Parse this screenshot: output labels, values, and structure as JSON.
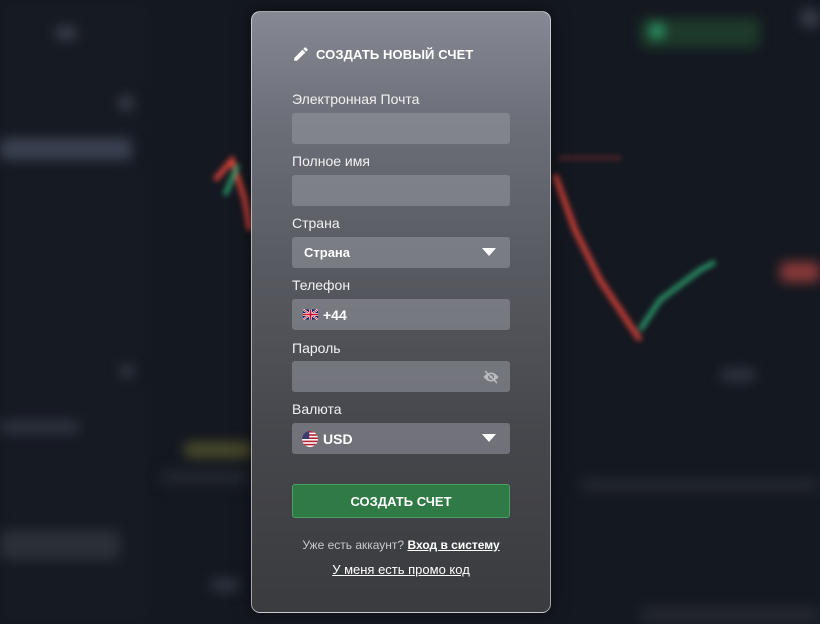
{
  "modal": {
    "title": "СОЗДАТЬ НОВЫЙ СЧЕТ",
    "title_icon": "pencil-icon",
    "fields": {
      "email": {
        "label": "Электронная Почта",
        "value": ""
      },
      "full_name": {
        "label": "Полное имя",
        "value": ""
      },
      "country": {
        "label": "Страна",
        "value": "Страна",
        "icon": "chevron-down-icon"
      },
      "phone": {
        "label": "Телефон",
        "value": "+44",
        "flag_icon": "uk-flag-icon"
      },
      "password": {
        "label": "Пароль",
        "value": "",
        "icon": "eye-slash-icon"
      },
      "currency": {
        "label": "Валюта",
        "value": "USD",
        "flag_icon": "us-flag-icon",
        "icon": "chevron-down-icon"
      }
    },
    "submit_label": "СОЗДАТЬ СЧЕТ",
    "have_account_text": "Уже есть аккаунт?",
    "login_link": "Вход в систему",
    "promo_link": "У меня есть промо код"
  },
  "colors": {
    "submit": "#2f7a45",
    "background": "#141820",
    "chart_up": "#2fb37a",
    "chart_down": "#e0443a"
  }
}
